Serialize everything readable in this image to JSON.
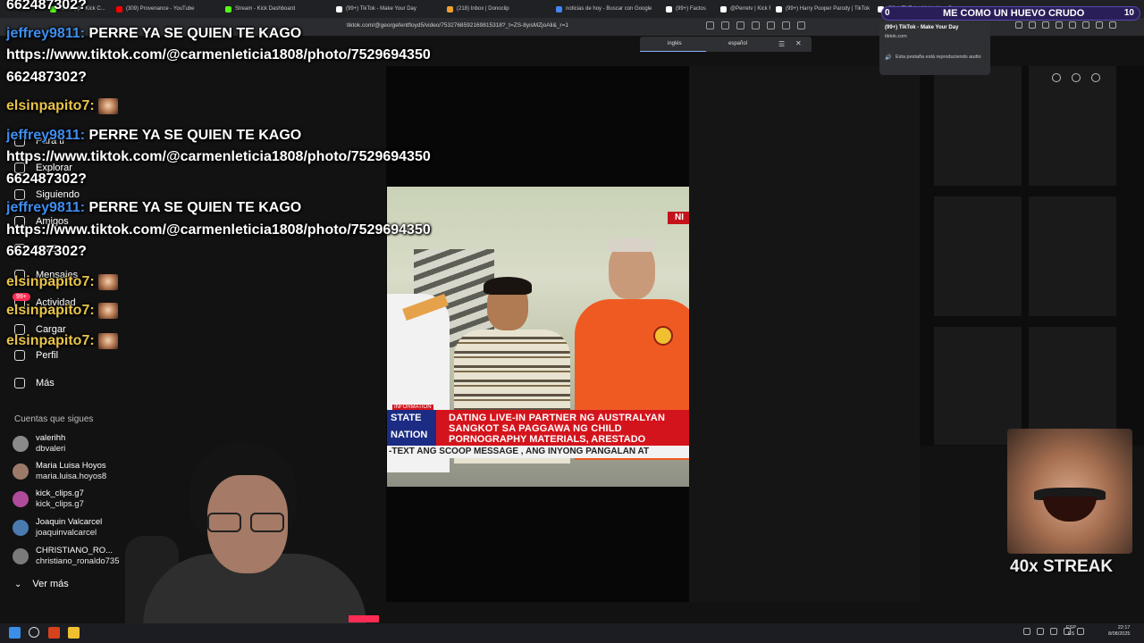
{
  "browser": {
    "tabs": [
      {
        "label": "Kick.app - Kick C...",
        "color": "#53fc18"
      },
      {
        "label": "(309) Provenance - YouTube",
        "color": "#ff0000"
      },
      {
        "label": "Stream - Kick Dashboard",
        "color": "#53fc18"
      },
      {
        "label": "(99+) TikTok - Make Your Day",
        "color": "#ffffff"
      },
      {
        "label": "(218) Inbox | Donoclip",
        "color": "#f0a030"
      },
      {
        "label": "noticias de hoy - Buscar con Google",
        "color": "#4285f4"
      },
      {
        "label": "(99+) Factos",
        "color": "#ffffff"
      },
      {
        "label": "@Perretv | Kick F...",
        "color": "#ffffff"
      },
      {
        "label": "(99+) Harry Pooper Parody | TikTok",
        "color": "#ffffff"
      },
      {
        "label": "(99+) TikTok - Make Your Day",
        "color": "#ffffff"
      }
    ],
    "url": "tiktok.com/@georgefentfloyd5/video/7532768592169815318?_t=ZS-8yisMZjoAli&_r=1"
  },
  "translate": {
    "lang_from": "inglés",
    "lang_to": "español"
  },
  "popup": {
    "title": "(99+) TikTok - Make Your Day",
    "domain": "tiktok.com",
    "note": "Esta pestaña está reproduciendo audio"
  },
  "goal": {
    "left": "0",
    "message": "ME COMO UN HUEVO CRUDO",
    "right": "10"
  },
  "sidebar": {
    "items": [
      {
        "label": "Para ti"
      },
      {
        "label": "Explorar"
      },
      {
        "label": "Siguiendo"
      },
      {
        "label": "Amigos"
      },
      {
        "label": "LIVE"
      },
      {
        "label": "Mensajes"
      },
      {
        "label": "Actividad"
      },
      {
        "label": "Cargar"
      },
      {
        "label": "Perfil"
      },
      {
        "label": "Más"
      }
    ],
    "activity_badge": "99+",
    "following_title": "Cuentas que sigues",
    "accounts": [
      {
        "name": "valerihh",
        "handle": "dbvaleri",
        "color": "#8a8a8a"
      },
      {
        "name": "Maria Luisa Hoyos",
        "handle": "maria.luisa.hoyos8",
        "color": "#9b7a6a"
      },
      {
        "name": "kick_clips.g7",
        "handle": "kick_clips.g7",
        "color": "#b04a9a"
      },
      {
        "name": "Joaquin Valcarcel",
        "handle": "joaquinvalcarcel",
        "color": "#4a7ab0"
      },
      {
        "name": "CHRISTIANO_RO...",
        "handle": "christiano_ronaldo735",
        "color": "#7a7a7a"
      }
    ],
    "see_more": "Ver más"
  },
  "video": {
    "logo": "NI",
    "tag": "INFORMATION",
    "state_line1": "STATE",
    "state_line2": "NATION",
    "headline1": "DATING LIVE-IN PARTNER NG AUSTRALYAN",
    "headline2": "SANGKOT SA PAGGAWA NG CHILD",
    "headline3": "PORNOGRAPHY MATERIALS, ARESTADO",
    "ticker": "-TEXT ANG SCOOP MESSAGE , ANG INYONG PANGALAN AT"
  },
  "chat": [
    {
      "user": "662487302?",
      "text": "",
      "kind": "cont"
    },
    {
      "user": "jeffrey9811:",
      "text": "PERRE YA SE QUIEN TE KAGO",
      "kind": "blue"
    },
    {
      "user": "",
      "text": "https://www.tiktok.com/@carmenleticia1808/photo/7529694350",
      "kind": "cont"
    },
    {
      "user": "",
      "text": "662487302?",
      "kind": "cont"
    },
    {
      "user": "elsinpapito7:",
      "text": "",
      "kind": "yellow"
    },
    {
      "user": "jeffrey9811:",
      "text": "PERRE YA SE QUIEN TE KAGO",
      "kind": "blue"
    },
    {
      "user": "",
      "text": "https://www.tiktok.com/@carmenleticia1808/photo/7529694350",
      "kind": "cont"
    },
    {
      "user": "",
      "text": "662487302?",
      "kind": "cont"
    },
    {
      "user": "jeffrey9811:",
      "text": "PERRE YA SE QUIEN TE KAGO",
      "kind": "blue"
    },
    {
      "user": "",
      "text": "https://www.tiktok.com/@carmenleticia1808/photo/7529694350",
      "kind": "cont"
    },
    {
      "user": "",
      "text": "662487302?",
      "kind": "cont"
    },
    {
      "user": "elsinpapito7:",
      "text": "",
      "kind": "yellow"
    },
    {
      "user": "elsinpapito7:",
      "text": "",
      "kind": "yellow"
    },
    {
      "user": "elsinpapito7:",
      "text": "",
      "kind": "yellow"
    }
  ],
  "streak": {
    "label": "40x STREAK"
  },
  "taskbar": {
    "lang": "ESP\nES",
    "time": "22:17",
    "date": "8/08/2025"
  }
}
